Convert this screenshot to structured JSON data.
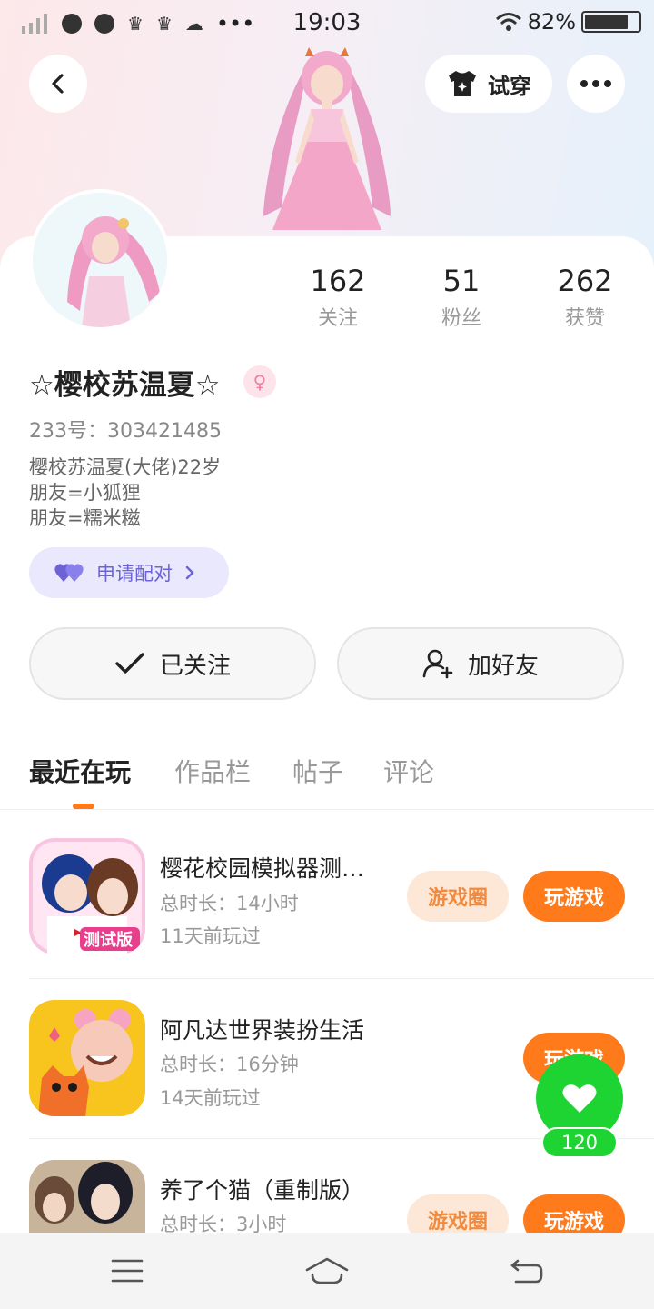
{
  "status_bar": {
    "time": "19:03",
    "battery_text": "82%",
    "battery_level": 0.82,
    "dots": "•••"
  },
  "header": {
    "back_icon": "chevron-left-icon",
    "tryon_label": "试穿",
    "tryon_icon": "shirt-sparkle-icon",
    "more_icon": "more-horizontal-icon"
  },
  "stats": [
    {
      "value": "162",
      "label": "关注"
    },
    {
      "value": "51",
      "label": "粉丝"
    },
    {
      "value": "262",
      "label": "获赞"
    }
  ],
  "profile": {
    "nickname": "☆樱校苏温夏☆",
    "gender_icon": "female-icon",
    "gender_symbol": "♀",
    "uid": "233号：303421485",
    "bio_lines": [
      "樱校苏温夏(大佬)22岁",
      "朋友=小狐狸",
      "朋友=糯米糍"
    ],
    "pair_label": "申请配对"
  },
  "actions": {
    "follow_label": "已关注",
    "add_friend_label": "加好友"
  },
  "tabs": [
    {
      "label": "最近在玩",
      "active": true
    },
    {
      "label": "作品栏",
      "active": false
    },
    {
      "label": "帖子",
      "active": false
    },
    {
      "label": "评论",
      "active": false
    }
  ],
  "games": [
    {
      "title": "樱花校园模拟器测…",
      "duration": "总时长：14小时",
      "last_played": "11天前玩过",
      "show_circle": true,
      "icon_badge": "测试版"
    },
    {
      "title": "阿凡达世界装扮生活",
      "duration": "总时长：16分钟",
      "last_played": "14天前玩过",
      "show_circle": false
    },
    {
      "title": "养了个猫（重制版）",
      "duration": "总时长：3小时",
      "last_played": "",
      "show_circle": true
    }
  ],
  "buttons": {
    "circle_label": "游戏圈",
    "play_label": "玩游戏"
  },
  "floating_like": {
    "count": "120",
    "icon": "heart-icon"
  },
  "colors": {
    "accent": "#ff7a1a",
    "accent_light": "#fde7d6",
    "pair_bg": "#e9e8fd",
    "pair_text": "#6d63d6",
    "like_green": "#1dd433"
  }
}
